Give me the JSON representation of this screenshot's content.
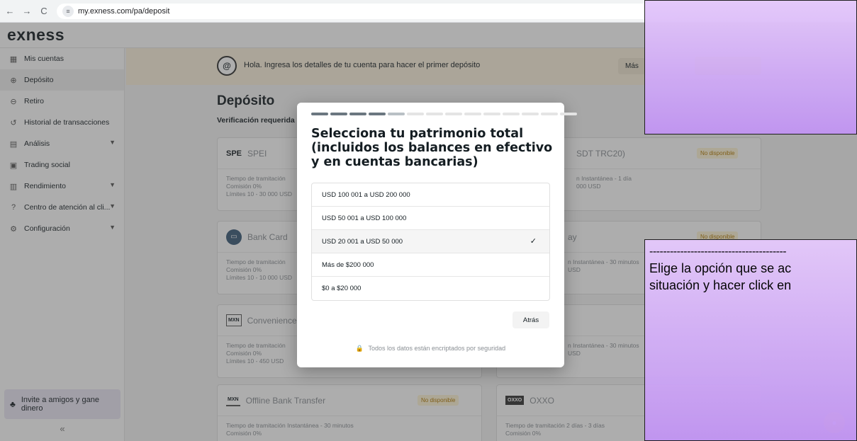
{
  "browser": {
    "back": "←",
    "forward": "→",
    "reload": "C",
    "url": "my.exness.com/pa/deposit"
  },
  "header": {
    "logo": "exness"
  },
  "sidebar": {
    "items": [
      {
        "label": "Mis cuentas",
        "icon": "grid-icon"
      },
      {
        "label": "Depósito",
        "icon": "deposit-icon"
      },
      {
        "label": "Retiro",
        "icon": "withdraw-icon"
      },
      {
        "label": "Historial de transacciones",
        "icon": "history-icon"
      },
      {
        "label": "Análisis",
        "icon": "analysis-icon"
      },
      {
        "label": "Trading social",
        "icon": "social-icon"
      },
      {
        "label": "Rendimiento",
        "icon": "chart-icon"
      },
      {
        "label": "Centro de atención al cli...",
        "icon": "help-icon"
      },
      {
        "label": "Configuración",
        "icon": "gear-icon"
      }
    ],
    "invite": "Invite a amigos y gane dinero",
    "collapse": "«"
  },
  "banner": {
    "text": "Hola. Ingresa los detalles de tu cuenta para hacer el primer depósito",
    "more": "Más",
    "icon": "@"
  },
  "main": {
    "title": "Depósito",
    "subtitle": "Verificación requerida"
  },
  "cards": {
    "spei": {
      "logo": "SPE",
      "name": "SPEI",
      "line1": "Tiempo de tramitación",
      "line2": "Comisión  0%",
      "line3": "Límites  10 - 30 000 USD"
    },
    "usdt": {
      "name": "SDT TRC20)",
      "badge": "No disponible",
      "line1": "n  Instantánea - 1 día",
      "line2": "000 USD"
    },
    "bank": {
      "name": "Bank Card",
      "line1": "Tiempo de tramitación",
      "line2": "Comisión  0%",
      "line3": "Límites  10 - 10 000 USD"
    },
    "pay": {
      "name": "ay",
      "badge": "No disponible",
      "line1": "n  Instantánea - 30 minutos",
      "line2": "USD"
    },
    "conv": {
      "logo": "MXN",
      "name": "Convenience",
      "line1": "Tiempo de tramitación",
      "line2": "Comisión  0%",
      "line3": "Límites  10 - 450 USD"
    },
    "other": {
      "line1": "n  Instantánea - 30 minutos",
      "line2": "USD"
    },
    "offline": {
      "logo": "MXN",
      "name": "Offline Bank Transfer",
      "badge": "No disponible",
      "line1": "Tiempo de tramitación  Instantánea - 30 minutos",
      "line2": "Comisión  0%"
    },
    "oxxo": {
      "logo": "OXXO",
      "name": "OXXO",
      "line1": "Tiempo de tramitación  2 días - 3 días",
      "line2": "Comisión  0%"
    }
  },
  "modal": {
    "progress": {
      "total": 14,
      "done": 4,
      "partial": 1
    },
    "title": "Selecciona tu patrimonio total (incluidos los balances en efectivo y en cuentas bancarias)",
    "options": [
      {
        "label": "USD 100 001 a USD 200 000",
        "selected": false
      },
      {
        "label": "USD 50 001 a USD 100 000",
        "selected": false
      },
      {
        "label": "USD 20 001 a USD 50 000",
        "selected": true
      },
      {
        "label": "Más de $200 000",
        "selected": false
      },
      {
        "label": "$0 a $20 000",
        "selected": false
      }
    ],
    "check": "✓",
    "back": "Atrás",
    "secure": "Todos los datos están encriptados por seguridad",
    "secure_icon": "🔒"
  },
  "annotation": {
    "dashes": "----------------------------------------",
    "line1": "Elige la opción que se ac",
    "line2": "situación y hacer click en"
  },
  "colors": {
    "accent": "#ffde02",
    "annotation_top": "#e4c8fb",
    "annotation_bottom": "#c195f2"
  }
}
